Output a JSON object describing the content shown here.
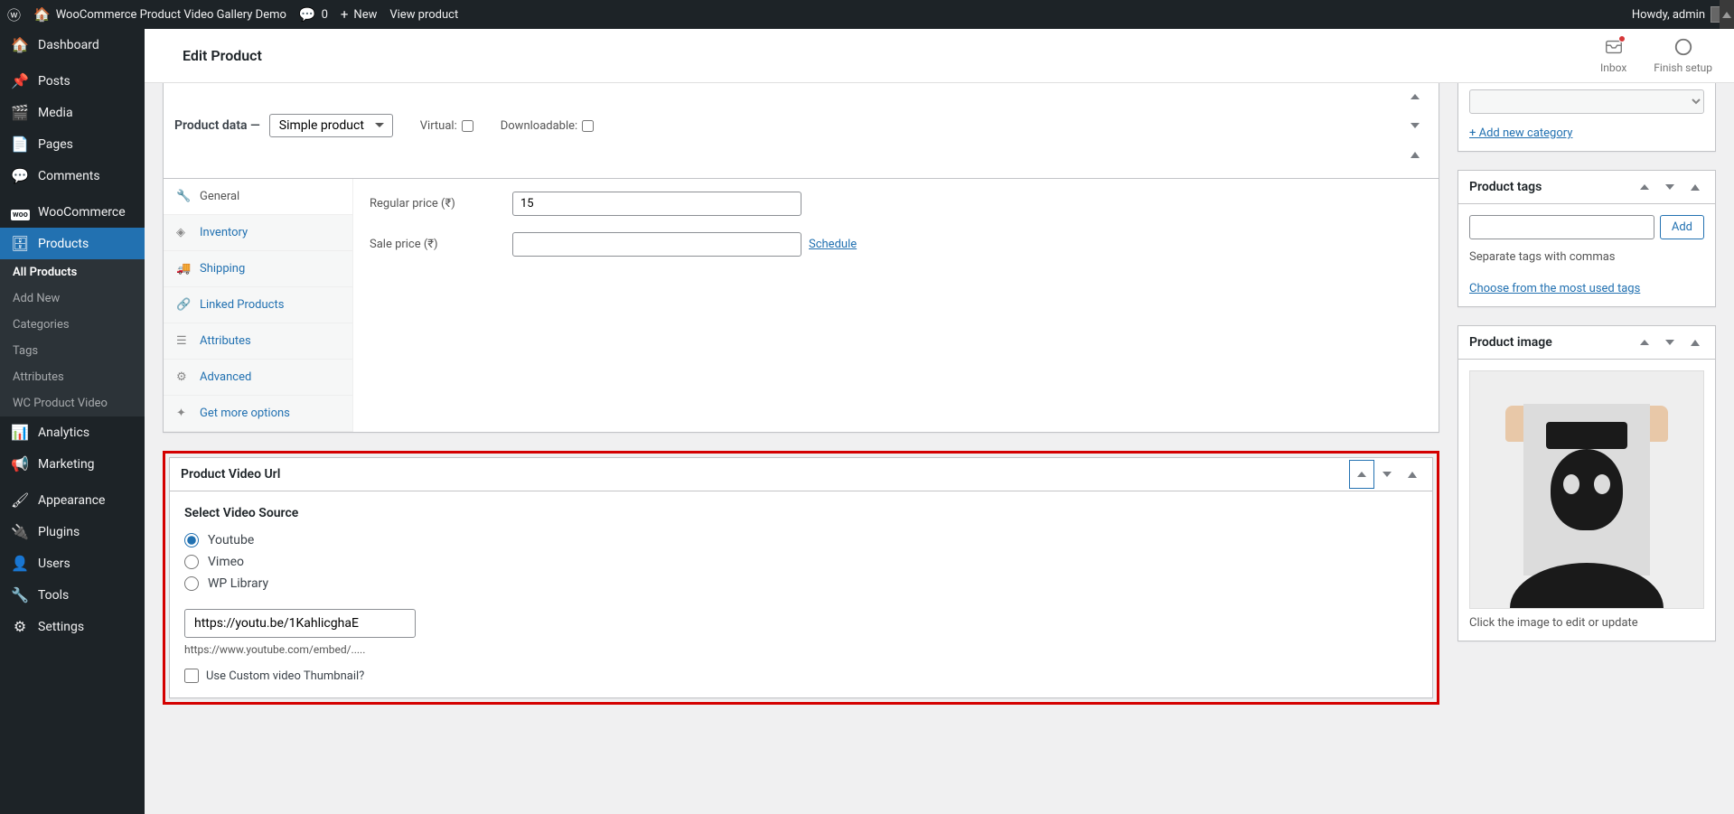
{
  "adminbar": {
    "site_title": "WooCommerce Product Video Gallery Demo",
    "comments": "0",
    "new_label": "New",
    "view_product": "View product",
    "howdy": "Howdy, admin"
  },
  "sidebar": {
    "items": [
      {
        "label": "Dashboard",
        "icon": "◐"
      },
      {
        "label": "Posts",
        "icon": "📌"
      },
      {
        "label": "Media",
        "icon": "🖼"
      },
      {
        "label": "Pages",
        "icon": "📄"
      },
      {
        "label": "Comments",
        "icon": "💬"
      },
      {
        "label": "WooCommerce",
        "icon": "woo"
      },
      {
        "label": "Products",
        "icon": "📦"
      },
      {
        "label": "Analytics",
        "icon": "📊"
      },
      {
        "label": "Marketing",
        "icon": "📣"
      },
      {
        "label": "Appearance",
        "icon": "🖌"
      },
      {
        "label": "Plugins",
        "icon": "🔌"
      },
      {
        "label": "Users",
        "icon": "👤"
      },
      {
        "label": "Tools",
        "icon": "🔧"
      },
      {
        "label": "Settings",
        "icon": "⚙"
      }
    ],
    "products_submenu": [
      "All Products",
      "Add New",
      "Categories",
      "Tags",
      "Attributes",
      "WC Product Video"
    ]
  },
  "header": {
    "title": "Edit Product",
    "inbox": "Inbox",
    "finish": "Finish setup"
  },
  "product_data": {
    "title": "Product data —",
    "type": "Simple product",
    "virtual": "Virtual:",
    "downloadable": "Downloadable:",
    "tabs": [
      "General",
      "Inventory",
      "Shipping",
      "Linked Products",
      "Attributes",
      "Advanced",
      "Get more options"
    ],
    "regular_price_label": "Regular price (₹)",
    "regular_price": "15",
    "sale_price_label": "Sale price (₹)",
    "sale_price": "",
    "schedule": "Schedule"
  },
  "video_box": {
    "title": "Product Video Url",
    "select_source": "Select Video Source",
    "opt_youtube": "Youtube",
    "opt_vimeo": "Vimeo",
    "opt_wp": "WP Library",
    "url": "https://youtu.be/1KahlicghaE",
    "hint": "https://www.youtube.com/embed/.....",
    "custom_thumb": "Use Custom video Thumbnail?"
  },
  "side": {
    "add_category": "+ Add new category",
    "tags_title": "Product tags",
    "tags_add": "Add",
    "tags_help": "Separate tags with commas",
    "tags_choose": "Choose from the most used tags",
    "image_title": "Product image",
    "image_help": "Click the image to edit or update"
  }
}
